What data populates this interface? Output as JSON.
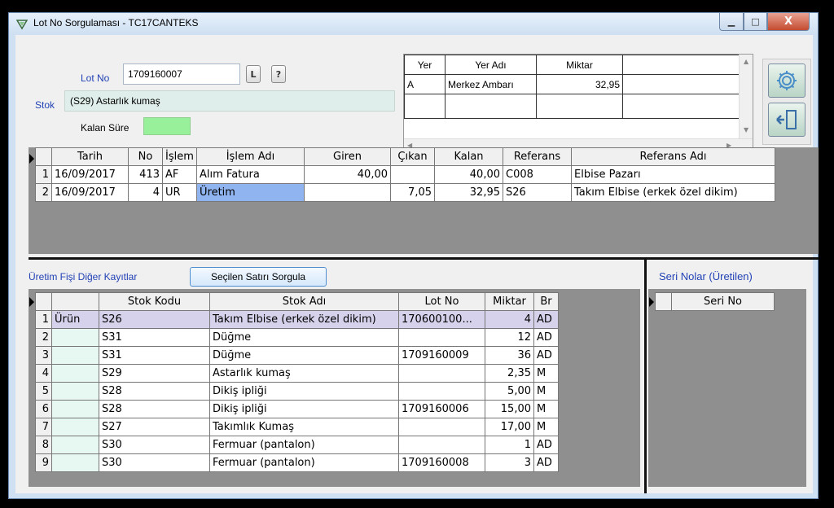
{
  "window": {
    "title": "Lot No Sorgulaması - TC17CANTEKS",
    "min_label": "▁",
    "max_label": "□",
    "close_label": "X"
  },
  "form": {
    "lot_no_label": "Lot No",
    "lot_no_value": "1709160007",
    "l_button": "L",
    "help_button": "?",
    "stok_label": "Stok",
    "stok_value": "(S29) Astarlık kumaş",
    "kalan_sure_label": "Kalan Süre",
    "kalan_sure_color": "#99f09a"
  },
  "yer_grid": {
    "headers": [
      "Yer",
      "Yer Adı",
      "Miktar"
    ],
    "rows": [
      [
        "A",
        "Merkez Ambarı",
        "32,95"
      ]
    ]
  },
  "hareket_grid": {
    "headers": [
      "Tarih",
      "No",
      "İşlem",
      "İşlem Adı",
      "Giren",
      "Çıkan",
      "Kalan",
      "Referans",
      "Referans Adı"
    ],
    "rows": [
      [
        "1",
        "16/09/2017",
        "413",
        "AF",
        "Alım Fatura",
        "40,00",
        "",
        "40,00",
        "C008",
        "Elbise Pazarı"
      ],
      [
        "2",
        "16/09/2017",
        "4",
        "UR",
        "Üretim",
        "",
        "7,05",
        "32,95",
        "S26",
        "Takım Elbise (erkek özel dikim)"
      ]
    ]
  },
  "uretim": {
    "label": "Üretim Fişi Diğer Kayıtlar",
    "sorgula_button": "Seçilen Satırı Sorgula",
    "headers": [
      "Stok Kodu",
      "Stok Adı",
      "Lot No",
      "Miktar",
      "Br"
    ],
    "rows": [
      [
        "1",
        "Ürün",
        "S26",
        "Takım Elbise (erkek özel dikim)",
        "170600100...",
        "4",
        "AD"
      ],
      [
        "2",
        "",
        "S31",
        "Düğme",
        "",
        "12",
        "AD"
      ],
      [
        "3",
        "",
        "S31",
        "Düğme",
        "1709160009",
        "36",
        "AD"
      ],
      [
        "4",
        "",
        "S29",
        "Astarlık kumaş",
        "",
        "2,35",
        "M"
      ],
      [
        "5",
        "",
        "S28",
        "Dikiş ipliği",
        "",
        "5,00",
        "M"
      ],
      [
        "6",
        "",
        "S28",
        "Dikiş ipliği",
        "1709160006",
        "15,00",
        "M"
      ],
      [
        "7",
        "",
        "S27",
        "Takımlık Kumaş",
        "",
        "17,00",
        "M"
      ],
      [
        "8",
        "",
        "S30",
        "Fermuar (pantalon)",
        "",
        "1",
        "AD"
      ],
      [
        "9",
        "",
        "S30",
        "Fermuar (pantalon)",
        "1709160008",
        "3",
        "AD"
      ]
    ]
  },
  "seri": {
    "label": "Seri Nolar (Üretilen)",
    "header": "Seri No"
  },
  "icons": {
    "settings": "gear-icon",
    "exit": "exit-door-icon",
    "title": "app-icon"
  }
}
